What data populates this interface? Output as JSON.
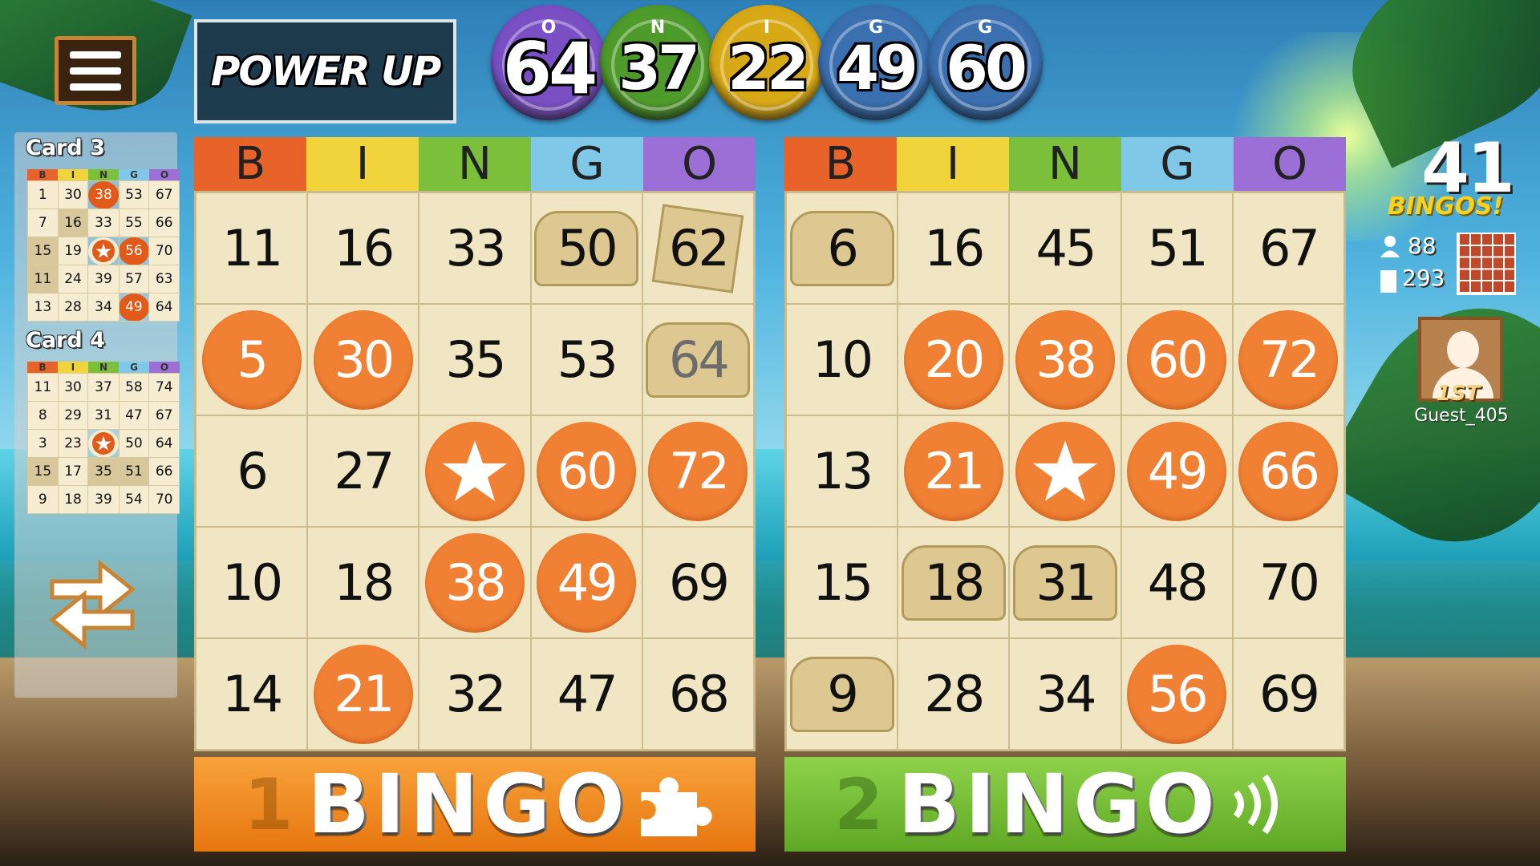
{
  "powerup_label": "POWER UP",
  "called_balls": [
    {
      "letter": "O",
      "number": "64",
      "color": "#7a4fc4"
    },
    {
      "letter": "N",
      "number": "37",
      "color": "#4e9a2a"
    },
    {
      "letter": "I",
      "number": "22",
      "color": "#d8a916"
    },
    {
      "letter": "G",
      "number": "49",
      "color": "#3a6fb0"
    },
    {
      "letter": "G",
      "number": "60",
      "color": "#3a6fb0"
    }
  ],
  "header_letters": [
    "B",
    "I",
    "N",
    "G",
    "O"
  ],
  "header_colors": [
    "#e8632a",
    "#f1d33c",
    "#7bbf3a",
    "#7fc8e8",
    "#9b6fd6"
  ],
  "mini_cards": [
    {
      "title": "Card 3",
      "rows": [
        [
          "1",
          "30",
          "38",
          "53",
          "67"
        ],
        [
          "7",
          "16",
          "33",
          "55",
          "66"
        ],
        [
          "15",
          "19",
          "★",
          "56",
          "70"
        ],
        [
          "11",
          "24",
          "39",
          "57",
          "63"
        ],
        [
          "13",
          "28",
          "34",
          "49",
          "64"
        ]
      ],
      "marked": [
        [
          0,
          2
        ],
        [
          2,
          2
        ],
        [
          2,
          3
        ],
        [
          4,
          3
        ]
      ],
      "treasure": [
        [
          1,
          1
        ],
        [
          2,
          0
        ],
        [
          3,
          0
        ]
      ]
    },
    {
      "title": "Card 4",
      "rows": [
        [
          "11",
          "30",
          "37",
          "58",
          "74"
        ],
        [
          "8",
          "29",
          "31",
          "47",
          "67"
        ],
        [
          "3",
          "23",
          "★",
          "50",
          "64"
        ],
        [
          "15",
          "17",
          "35",
          "51",
          "66"
        ],
        [
          "9",
          "18",
          "39",
          "54",
          "70"
        ]
      ],
      "marked": [
        [
          2,
          2
        ]
      ],
      "treasure": [
        [
          3,
          0
        ],
        [
          3,
          2
        ],
        [
          3,
          3
        ]
      ]
    }
  ],
  "cards": [
    {
      "rows": [
        [
          "11",
          "16",
          "33",
          "50",
          "62"
        ],
        [
          "5",
          "30",
          "35",
          "53",
          "64"
        ],
        [
          "6",
          "27",
          "★",
          "60",
          "72"
        ],
        [
          "10",
          "18",
          "38",
          "49",
          "69"
        ],
        [
          "14",
          "21",
          "32",
          "47",
          "68"
        ]
      ],
      "marked": [
        [
          1,
          0
        ],
        [
          1,
          1
        ],
        [
          2,
          2
        ],
        [
          2,
          3
        ],
        [
          2,
          4
        ],
        [
          3,
          2
        ],
        [
          3,
          3
        ],
        [
          4,
          1
        ]
      ],
      "chest": [
        [
          0,
          3
        ],
        [
          1,
          4
        ]
      ],
      "scroll": [
        [
          0,
          4
        ]
      ],
      "bingo_count": "1",
      "bingo_label": "BINGO",
      "button_color": "#f08a1a"
    },
    {
      "rows": [
        [
          "6",
          "16",
          "45",
          "51",
          "67"
        ],
        [
          "10",
          "20",
          "38",
          "60",
          "72"
        ],
        [
          "13",
          "21",
          "★",
          "49",
          "66"
        ],
        [
          "15",
          "18",
          "31",
          "48",
          "70"
        ],
        [
          "9",
          "28",
          "34",
          "56",
          "69"
        ]
      ],
      "marked": [
        [
          1,
          1
        ],
        [
          1,
          2
        ],
        [
          1,
          3
        ],
        [
          1,
          4
        ],
        [
          2,
          1
        ],
        [
          2,
          2
        ],
        [
          2,
          3
        ],
        [
          2,
          4
        ],
        [
          4,
          3
        ]
      ],
      "chest": [
        [
          0,
          0
        ],
        [
          3,
          1
        ],
        [
          3,
          2
        ],
        [
          4,
          0
        ]
      ],
      "scroll": [],
      "bingo_count": "2",
      "bingo_label": "BINGO",
      "button_color": "#7cc33a"
    }
  ],
  "bingos_remaining": "41",
  "bingos_label": "BINGOS!",
  "players_count": "88",
  "cards_count": "293",
  "player_rank": "1ST",
  "player_name": "Guest_405"
}
